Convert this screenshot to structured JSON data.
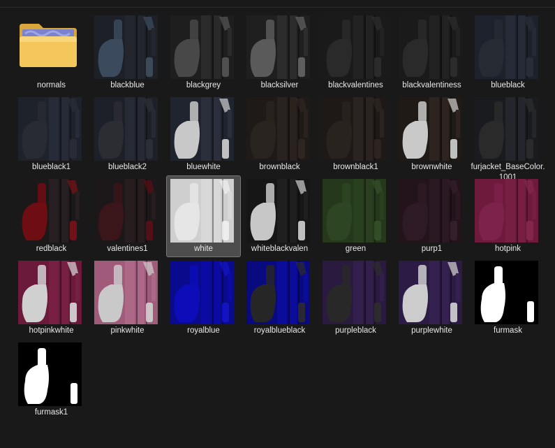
{
  "items": [
    {
      "name": "normals",
      "kind": "folder"
    },
    {
      "name": "blackblue",
      "bg": "#1d2026",
      "a": "#3b4a5c",
      "b": "#23272d",
      "c": "#3f4e5f"
    },
    {
      "name": "blackgrey",
      "bg": "#1e1e1e",
      "a": "#484848",
      "b": "#2a2a2a",
      "c": "#555555"
    },
    {
      "name": "blacksilver",
      "bg": "#1f1f1f",
      "a": "#5a5a5a",
      "b": "#2c2c2c",
      "c": "#656565"
    },
    {
      "name": "blackvalentines",
      "bg": "#1a1a1a",
      "a": "#2a2a2a",
      "b": "#222222",
      "c": "#2e2e2e"
    },
    {
      "name": "blackvalentiness",
      "bg": "#1a1a1a",
      "a": "#2a2a2a",
      "b": "#222222",
      "c": "#2e2e2e"
    },
    {
      "name": "blueblack",
      "bg": "#1d212b",
      "a": "#262a32",
      "b": "#252a36",
      "c": "#2a2e38"
    },
    {
      "name": "blueblack1",
      "bg": "#1e222b",
      "a": "#282b31",
      "b": "#262b37",
      "c": "#2a2e38"
    },
    {
      "name": "blueblack2",
      "bg": "#1d2029",
      "a": "#2b2d32",
      "b": "#252a35",
      "c": "#2d3038"
    },
    {
      "name": "bluewhite",
      "bg": "#20242e",
      "a": "#c8c8c8",
      "b": "#2a2f3b",
      "c": "#d2d2d2"
    },
    {
      "name": "brownblack",
      "bg": "#1f1917",
      "a": "#2a2421",
      "b": "#2a221e",
      "c": "#2e2723"
    },
    {
      "name": "brownblack1",
      "bg": "#1e1917",
      "a": "#29231f",
      "b": "#2b231f",
      "c": "#2d2622"
    },
    {
      "name": "brownwhite",
      "bg": "#201a17",
      "a": "#c9c9c9",
      "b": "#2d2420",
      "c": "#d2d2d2"
    },
    {
      "name": "furjacket_BaseColor.1001",
      "bg": "#1a1b1f",
      "a": "#2a2a2a",
      "b": "#24262b",
      "c": "#2e2e2e"
    },
    {
      "name": "redblack",
      "bg": "#1b1819",
      "a": "#6e0d12",
      "b": "#261e20",
      "c": "#7a1217"
    },
    {
      "name": "valentines1",
      "bg": "#1c1718",
      "a": "#3a1519",
      "b": "#271d1f",
      "c": "#5a1016"
    },
    {
      "name": "white",
      "bg": "#cfcfcf",
      "a": "#e6e6e6",
      "b": "#d8d8d8",
      "c": "#f0f0f0",
      "selected": true
    },
    {
      "name": "whiteblackvalen",
      "bg": "#161616",
      "a": "#c7c7c7",
      "b": "#1f1f1f",
      "c": "#d0d0d0"
    },
    {
      "name": "green",
      "bg": "#25381c",
      "a": "#2e4523",
      "b": "#2a3f20",
      "c": "#34502a"
    },
    {
      "name": "purp1",
      "bg": "#23141c",
      "a": "#2e1a25",
      "b": "#2a1822",
      "c": "#34202b"
    },
    {
      "name": "hotpink",
      "bg": "#6e1a3d",
      "a": "#7d2248",
      "b": "#761f43",
      "c": "#85284f"
    },
    {
      "name": "hotpinkwhite",
      "bg": "#6c1a3c",
      "a": "#d0d0d0",
      "b": "#772043",
      "c": "#d8d8d8"
    },
    {
      "name": "pinkwhite",
      "bg": "#a05a7a",
      "a": "#c9c9c9",
      "b": "#ad6787",
      "c": "#d2d2d2"
    },
    {
      "name": "royalblue",
      "bg": "#0a0a8c",
      "a": "#0c0cb8",
      "b": "#0b0ba4",
      "c": "#1414c8"
    },
    {
      "name": "royalblueblack",
      "bg": "#0a0a80",
      "a": "#262626",
      "b": "#0c0c9a",
      "c": "#2c2c2c"
    },
    {
      "name": "purpleblack",
      "bg": "#2a1a40",
      "a": "#282828",
      "b": "#321f4b",
      "c": "#2e2e2e"
    },
    {
      "name": "purplewhite",
      "bg": "#2c1b44",
      "a": "#cccccc",
      "b": "#34214f",
      "c": "#d4d4d4"
    },
    {
      "name": "furmask",
      "bg": "#000000",
      "a": "#ffffff",
      "b": "#000000",
      "c": "#ffffff",
      "mask": true
    },
    {
      "name": "furmask1",
      "bg": "#000000",
      "a": "#ffffff",
      "b": "#000000",
      "c": "#ffffff",
      "mask": true
    }
  ]
}
